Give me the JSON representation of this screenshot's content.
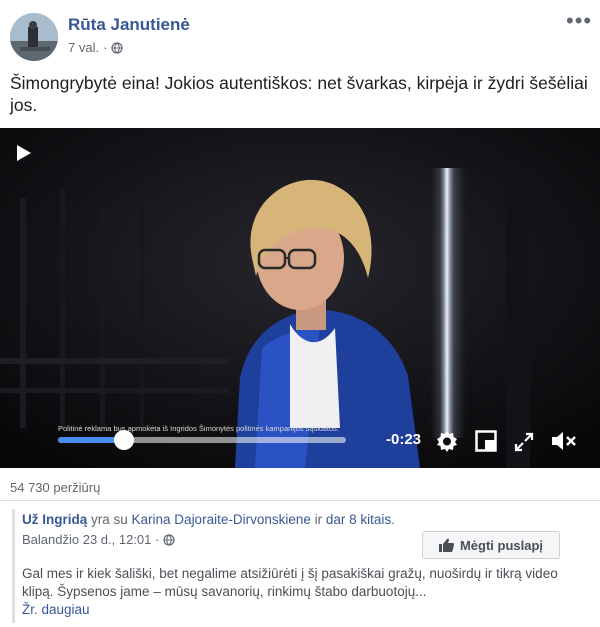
{
  "post": {
    "author": "Rūta Janutienė",
    "time": "7 val.",
    "more_label": "•••",
    "text": "Šimongrybytė eina! Jokios autentiškos: net švarkas, kirpėja ir žydri šešėliai jos."
  },
  "video": {
    "disclaimer": "Politinė reklama bus apmokėta iš Ingridos Šimonytės politinės kampanijos sąskaitos.",
    "time_remaining": "-0:23",
    "progress_fraction": 0.23,
    "accent_color": "#4a8cf0",
    "icons": [
      "play-icon",
      "settings-icon",
      "pip-icon",
      "fullscreen-icon",
      "mute-icon"
    ]
  },
  "views": "54 730 peržiūrų",
  "attached": {
    "page_name": "Už Ingridą",
    "with_text": " yra su ",
    "person": "Karina Dajoraite-Dirvonskiene",
    "and_text": " ir ",
    "others": "dar 8 kitais",
    "others_suffix": ".",
    "date": "Balandžio 23 d., 12:01 ·",
    "like_button": "Mėgti puslapį",
    "description": "Gal mes ir kiek šališki, bet negalime atsižiūrėti į šį pasakiškai gražų, nuoširdų ir tikrą video klipą. Šypsenos jame – mūsų savanorių, rinkimų štabo darbuotojų...",
    "see_more": "Žr. daugiau"
  },
  "colors": {
    "link": "#385898",
    "muted": "#606770"
  }
}
